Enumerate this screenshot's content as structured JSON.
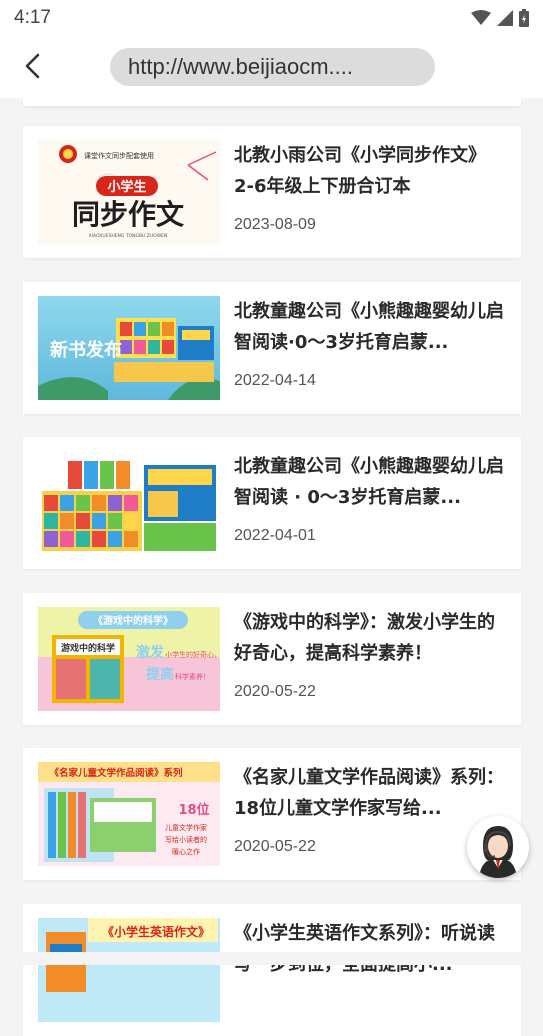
{
  "status_bar": {
    "time": "4:17"
  },
  "browser": {
    "url": "http://www.beijiaocm...."
  },
  "cards": [
    {
      "title": "北教小雨公司《小学同步作文》2-6年级上下册合订本",
      "date": "2023-08-09",
      "thumb": {
        "header": "课堂作文同步配套使用",
        "badge": "小学生",
        "main": "同步作文",
        "sub": "XIAOXUESHENG TONGBU ZUOWEN"
      }
    },
    {
      "title": "北教童趣公司《小熊趣趣婴幼儿启智阅读·0～3岁托育启蒙...",
      "date": "2022-04-14",
      "thumb": {
        "main": "新书发布"
      }
    },
    {
      "title": "北教童趣公司《小熊趣趣婴幼儿启智阅读 · 0～3岁托育启蒙...",
      "date": "2022-04-01",
      "thumb": {}
    },
    {
      "title": "《游戏中的科学》：激发小学生的好奇心，提高科学素养！",
      "date": "2020-05-22",
      "thumb": {
        "banner": "《游戏中的科学》",
        "book": "游戏中的科学",
        "text1": "激发",
        "text1b": "小学生的好奇心，",
        "text2": "提高",
        "text2b": "科学素养！"
      }
    },
    {
      "title": "《名家儿童文学作品阅读》系列：18位儿童文学作家写给...",
      "date": "2020-05-22",
      "thumb": {
        "banner": "《名家儿童文学作品阅读》系列",
        "num": "18位",
        "line1": "儿童文学作家",
        "line2": "写给小读者的",
        "line3": "暖心之作"
      }
    },
    {
      "title": "《小学生英语作文系列》：听说读写一步到位，全面提高小...",
      "date": "",
      "thumb": {
        "banner": "《小学生英语作文》"
      }
    }
  ],
  "colors": {
    "accent_red": "#d8261b",
    "background": "#f4f4f4",
    "url_pill": "#dcdcdc"
  },
  "icons": [
    "back-arrow-icon",
    "wifi-icon",
    "signal-icon",
    "battery-icon",
    "customer-service-icon"
  ]
}
